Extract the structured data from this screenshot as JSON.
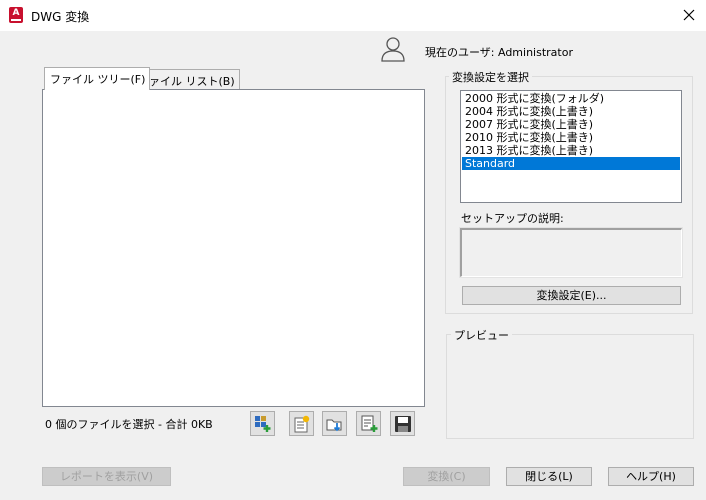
{
  "window": {
    "title": "DWG 変換",
    "app_icon_letter": "A"
  },
  "user": {
    "label": "現在のユーザ: Administrator"
  },
  "tabs": [
    {
      "label": "ファイル ツリー(F)",
      "active": true
    },
    {
      "label": "ファイル リスト(B)",
      "active": false
    }
  ],
  "status": {
    "text": "0 個のファイルを選択 - 合計 0KB"
  },
  "toolbar_icons": [
    "add-files-icon",
    "add-list-icon",
    "open-folder-icon",
    "append-list-icon",
    "save-list-icon"
  ],
  "conversion": {
    "group_title": "変換設定を選択",
    "items": [
      "2000 形式に変換(フォルダ)",
      "2004 形式に変換(上書き)",
      "2007 形式に変換(上書き)",
      "2010 形式に変換(上書き)",
      "2013 形式に変換(上書き)",
      "Standard"
    ],
    "selected_index": 5,
    "description_label": "セットアップの説明:",
    "settings_button": "変換設定(E)..."
  },
  "preview": {
    "group_title": "プレビュー"
  },
  "buttons": {
    "report": "レポートを表示(V)",
    "convert": "変換(C)",
    "close": "閉じる(L)",
    "help": "ヘルプ(H)"
  },
  "colors": {
    "selection": "#0078d7",
    "app_icon": "#c8102e"
  }
}
